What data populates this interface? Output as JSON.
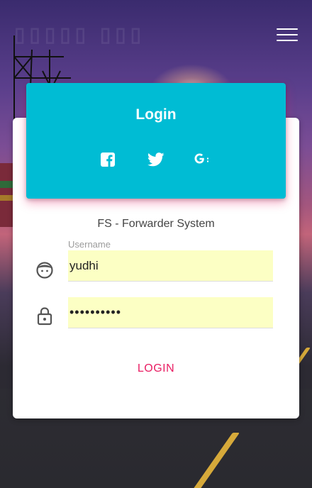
{
  "header": {
    "title": "Login",
    "social": [
      {
        "icon": "facebook-icon"
      },
      {
        "icon": "twitter-icon"
      },
      {
        "icon": "google-plus-icon"
      }
    ]
  },
  "app": {
    "subtitle": "FS - Forwarder System"
  },
  "form": {
    "username": {
      "label": "Username",
      "value": "yudhi",
      "icon": "face-icon"
    },
    "password": {
      "value": "••••••••••",
      "icon": "lock-icon"
    },
    "submit_label": "LOGIN"
  },
  "nav": {
    "menu_icon": "hamburger-menu-icon"
  },
  "colors": {
    "accent": "#00bcd4",
    "button_text": "#e91e63",
    "input_background": "#fcffc4"
  }
}
